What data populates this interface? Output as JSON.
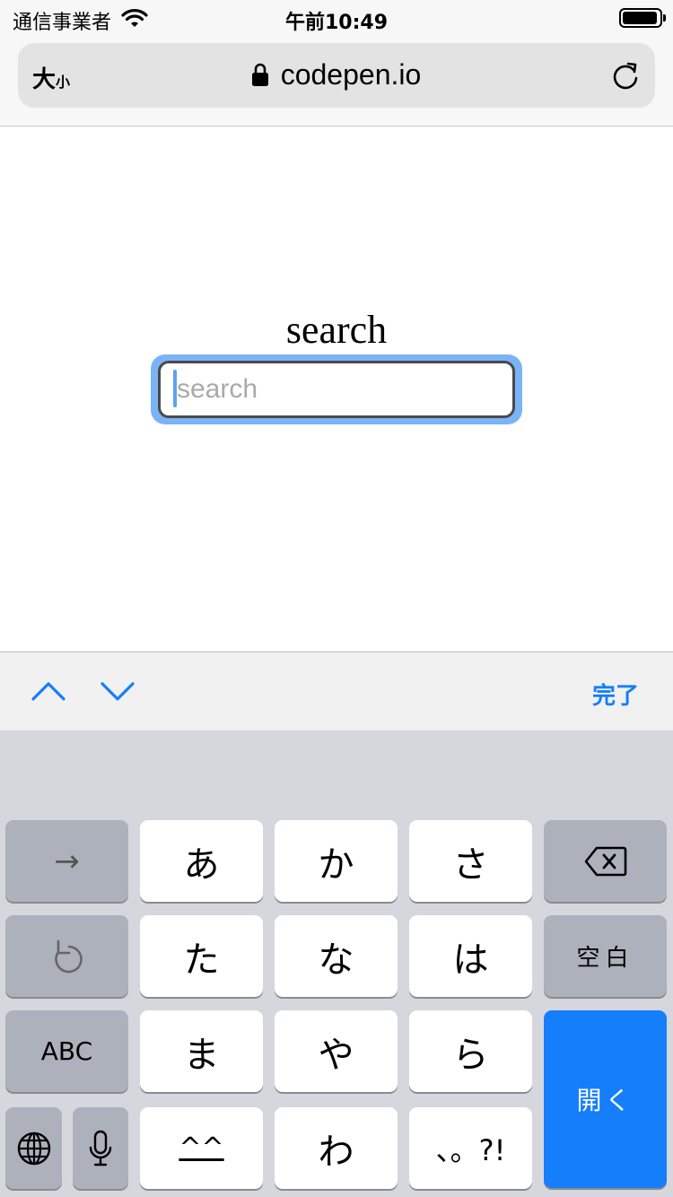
{
  "status_bar": {
    "carrier": "通信事業者",
    "time": "午前10:49",
    "battery_level": 0.95
  },
  "browser": {
    "text_size_big": "大",
    "text_size_small": "小",
    "url": "codepen.io"
  },
  "page": {
    "title": "search",
    "search_value": "",
    "search_placeholder": "search"
  },
  "accessory_bar": {
    "done_label": "完了"
  },
  "keyboard": {
    "keys": {
      "next": "→",
      "a": "あ",
      "ka": "か",
      "sa": "さ",
      "ta": "た",
      "na": "な",
      "ha": "は",
      "space": "空白",
      "abc": "ABC",
      "ma": "ま",
      "ya": "や",
      "ra": "ら",
      "return": "開く",
      "kaomoji": "^^",
      "wa": "わ",
      "punct": "、。?!"
    }
  },
  "colors": {
    "accent": "#147efb",
    "focus_ring": "#7bb3f7",
    "keyboard_bg": "#d5d7dd",
    "dark_key": "#adb1bb"
  },
  "icons": [
    "wifi-icon",
    "battery-icon",
    "lock-icon",
    "reload-icon",
    "chevron-up-icon",
    "chevron-down-icon",
    "backspace-icon",
    "undo-icon",
    "globe-icon",
    "microphone-icon"
  ]
}
